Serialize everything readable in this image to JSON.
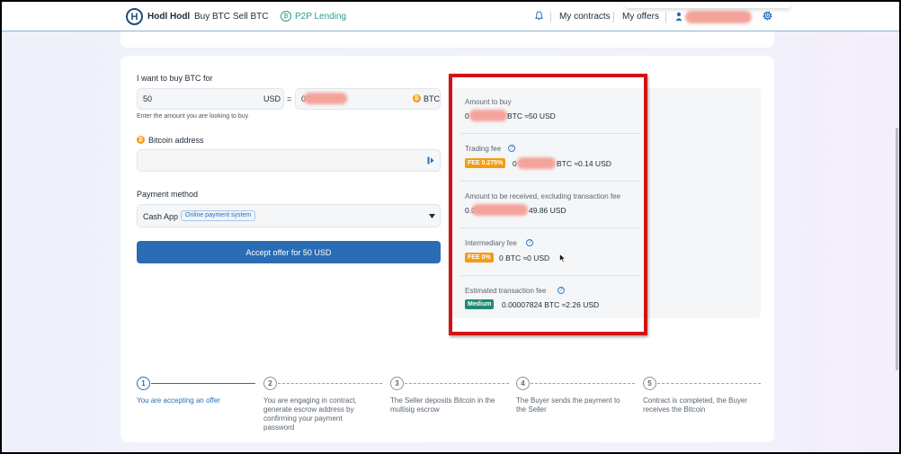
{
  "header": {
    "logo_letter": "H",
    "brand": "Hodl Hodl",
    "nav": {
      "buy": "Buy BTC",
      "sell": "Sell BTC",
      "p2p_lending": "P2P Lending",
      "p2p_icon_text": "₿"
    },
    "my_contracts": "My contracts",
    "my_offers": "My offers",
    "icons": [
      "bell-icon",
      "user-icon",
      "gear-icon"
    ]
  },
  "form": {
    "buy_label": "I want to buy BTC for",
    "amount_value": "50",
    "amount_currency": "USD",
    "equals": "=",
    "btc_prefix": "0",
    "btc_currency": "BTC",
    "amount_hint": "Enter the amount you are looking to buy",
    "address_label": "Bitcoin address",
    "address_value": "",
    "payment_label": "Payment method",
    "payment_value": "Cash App",
    "payment_badge": "Online payment system",
    "accept_button": "Accept offer for 50 USD",
    "coin_symbol": "₿"
  },
  "summary": {
    "amount_to_buy_label": "Amount to buy",
    "amount_to_buy_prefix": "0",
    "amount_to_buy_suffix": "BTC ≈50 USD",
    "trading_fee_label": "Trading fee",
    "trading_fee_badge": "FEE 0.275%",
    "trading_fee_prefix": "0",
    "trading_fee_suffix": "BTC ≈0.14 USD",
    "received_label": "Amount to be received, excluding transaction fee",
    "received_prefix": "0.0",
    "received_suffix": "49.86 USD",
    "intermediary_label": "Intermediary fee",
    "intermediary_badge": "FEE 0%",
    "intermediary_value": "0 BTC ≈0 USD",
    "estimated_label": "Estimated transaction fee",
    "estimated_badge": "Medium",
    "estimated_value": "0.00007824 BTC ≈2.26 USD",
    "info_symbol": "?"
  },
  "steps": [
    {
      "number": "1",
      "text": "You are accepting an offer"
    },
    {
      "number": "2",
      "text": "You are engaging in contract, generate escrow address by confirming your payment password"
    },
    {
      "number": "3",
      "text": "The Seller deposits Bitcoin in the multisig escrow"
    },
    {
      "number": "4",
      "text": "The Buyer sends the payment to the Seller"
    },
    {
      "number": "5",
      "text": "Contract is completed, the Buyer receives the Bitcoin"
    }
  ],
  "colors": {
    "primary": "#2a6db5",
    "highlight_box": "#d21414",
    "fee_badge": "#f39c12",
    "medium_badge": "#1f8a70",
    "p2p": "#2a9d8f"
  }
}
